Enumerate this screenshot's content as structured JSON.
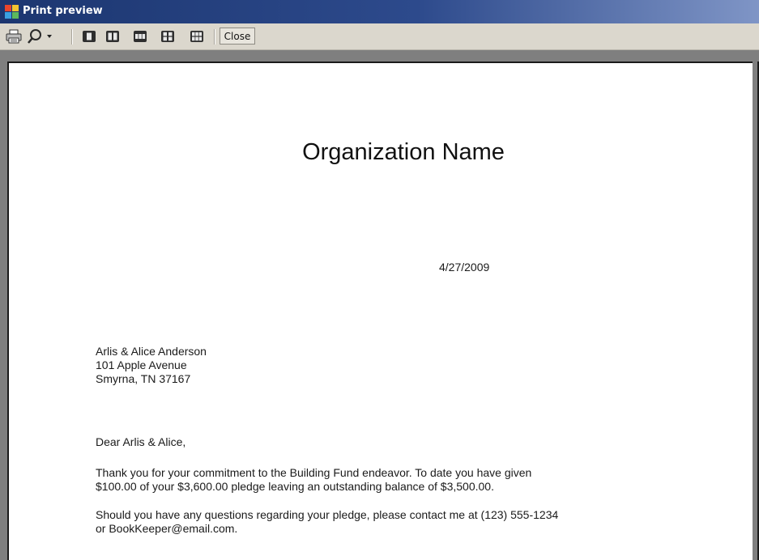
{
  "window": {
    "title": "Print preview"
  },
  "toolbar": {
    "close_label": "Close"
  },
  "document": {
    "organization": "Organization Name",
    "date": "4/27/2009",
    "address": [
      "Arlis & Alice Anderson",
      "101 Apple Avenue",
      "Smyrna, TN  37167"
    ],
    "salutation": "Dear Arlis & Alice,",
    "paragraph1": [
      "Thank you for your commitment to the Building Fund endeavor.  To date you have given",
      "$100.00 of your $3,600.00 pledge leaving an outstanding balance of $3,500.00."
    ],
    "paragraph2": [
      "Should you have any questions regarding your pledge, please contact me at (123) 555-1234",
      "or BookKeeper@email.com."
    ]
  }
}
